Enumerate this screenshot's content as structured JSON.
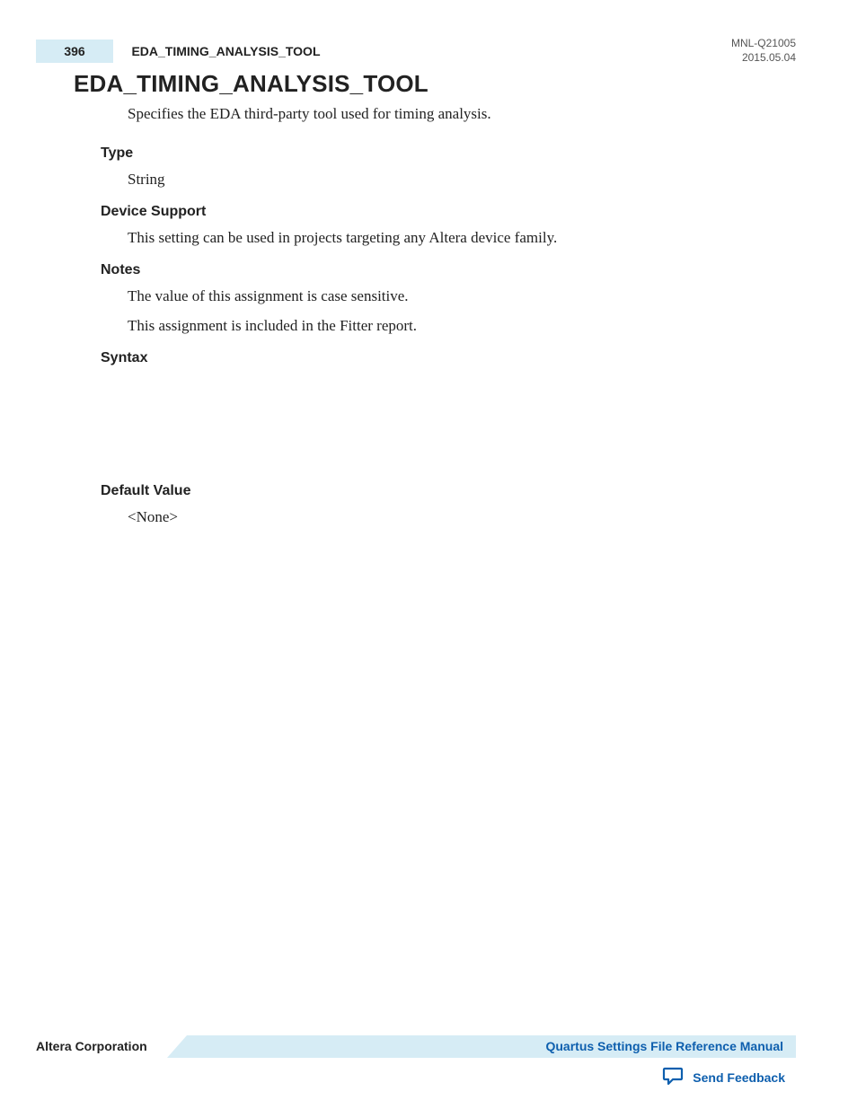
{
  "header": {
    "page_number": "396",
    "running_title": "EDA_TIMING_ANALYSIS_TOOL",
    "doc_id": "MNL-Q21005",
    "doc_date": "2015.05.04"
  },
  "title": "EDA_TIMING_ANALYSIS_TOOL",
  "intro": "Specifies the EDA third-party tool used for timing analysis.",
  "sections": {
    "type": {
      "heading": "Type",
      "value": "String"
    },
    "device_support": {
      "heading": "Device Support",
      "value": "This setting can be used in projects targeting any Altera device family."
    },
    "notes": {
      "heading": "Notes",
      "lines": [
        "The value of this assignment is case sensitive.",
        "This assignment is included in the Fitter report."
      ]
    },
    "syntax": {
      "heading": "Syntax"
    },
    "default_value": {
      "heading": "Default Value",
      "value": "<None>"
    }
  },
  "footer": {
    "company": "Altera Corporation",
    "manual_link": "Quartus Settings File Reference Manual",
    "feedback": "Send Feedback"
  }
}
